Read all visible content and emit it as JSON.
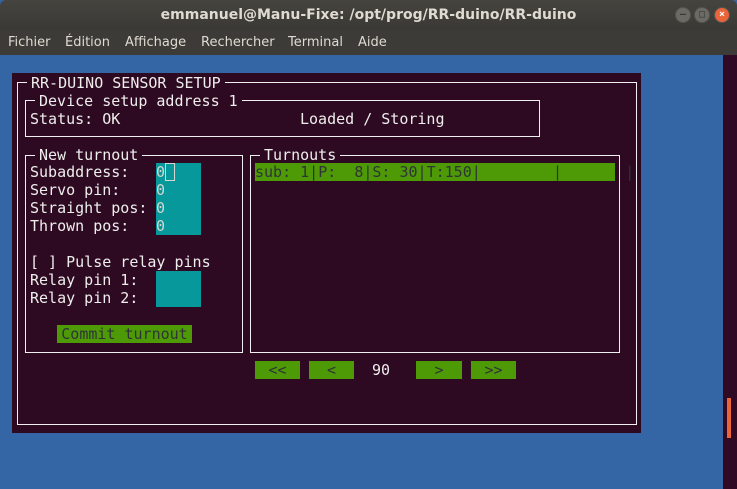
{
  "window": {
    "title": "emmanuel@Manu-Fixe: /opt/prog/RR-duino/RR-duino"
  },
  "menu": [
    "Fichier",
    "Édition",
    "Affichage",
    "Rechercher",
    "Terminal",
    "Aide"
  ],
  "app": {
    "title": "RR-DUINO SENSOR SETUP",
    "device": {
      "title": "Device setup address 1",
      "status": "Status: OK",
      "mode": "Loaded / Storing"
    },
    "new_turnout": {
      "title": "New turnout",
      "fields": [
        {
          "label": "Subaddress:",
          "value": "0"
        },
        {
          "label": "Servo pin:",
          "value": "0"
        },
        {
          "label": "Straight pos:",
          "value": "0"
        },
        {
          "label": "Thrown pos:",
          "value": "0"
        }
      ],
      "pulse_checkbox": "[ ] Pulse relay pins",
      "relay1_label": "Relay pin 1:",
      "relay2_label": "Relay pin 2:",
      "commit": "Commit turnout"
    },
    "turnouts": {
      "title": "Turnouts",
      "rows": [
        "sub: 1|P:  8|S: 30|T:150|        |       |"
      ]
    },
    "pager": {
      "first": "<<",
      "prev": "<",
      "value": "90",
      "next": ">",
      "last": ">>"
    }
  }
}
